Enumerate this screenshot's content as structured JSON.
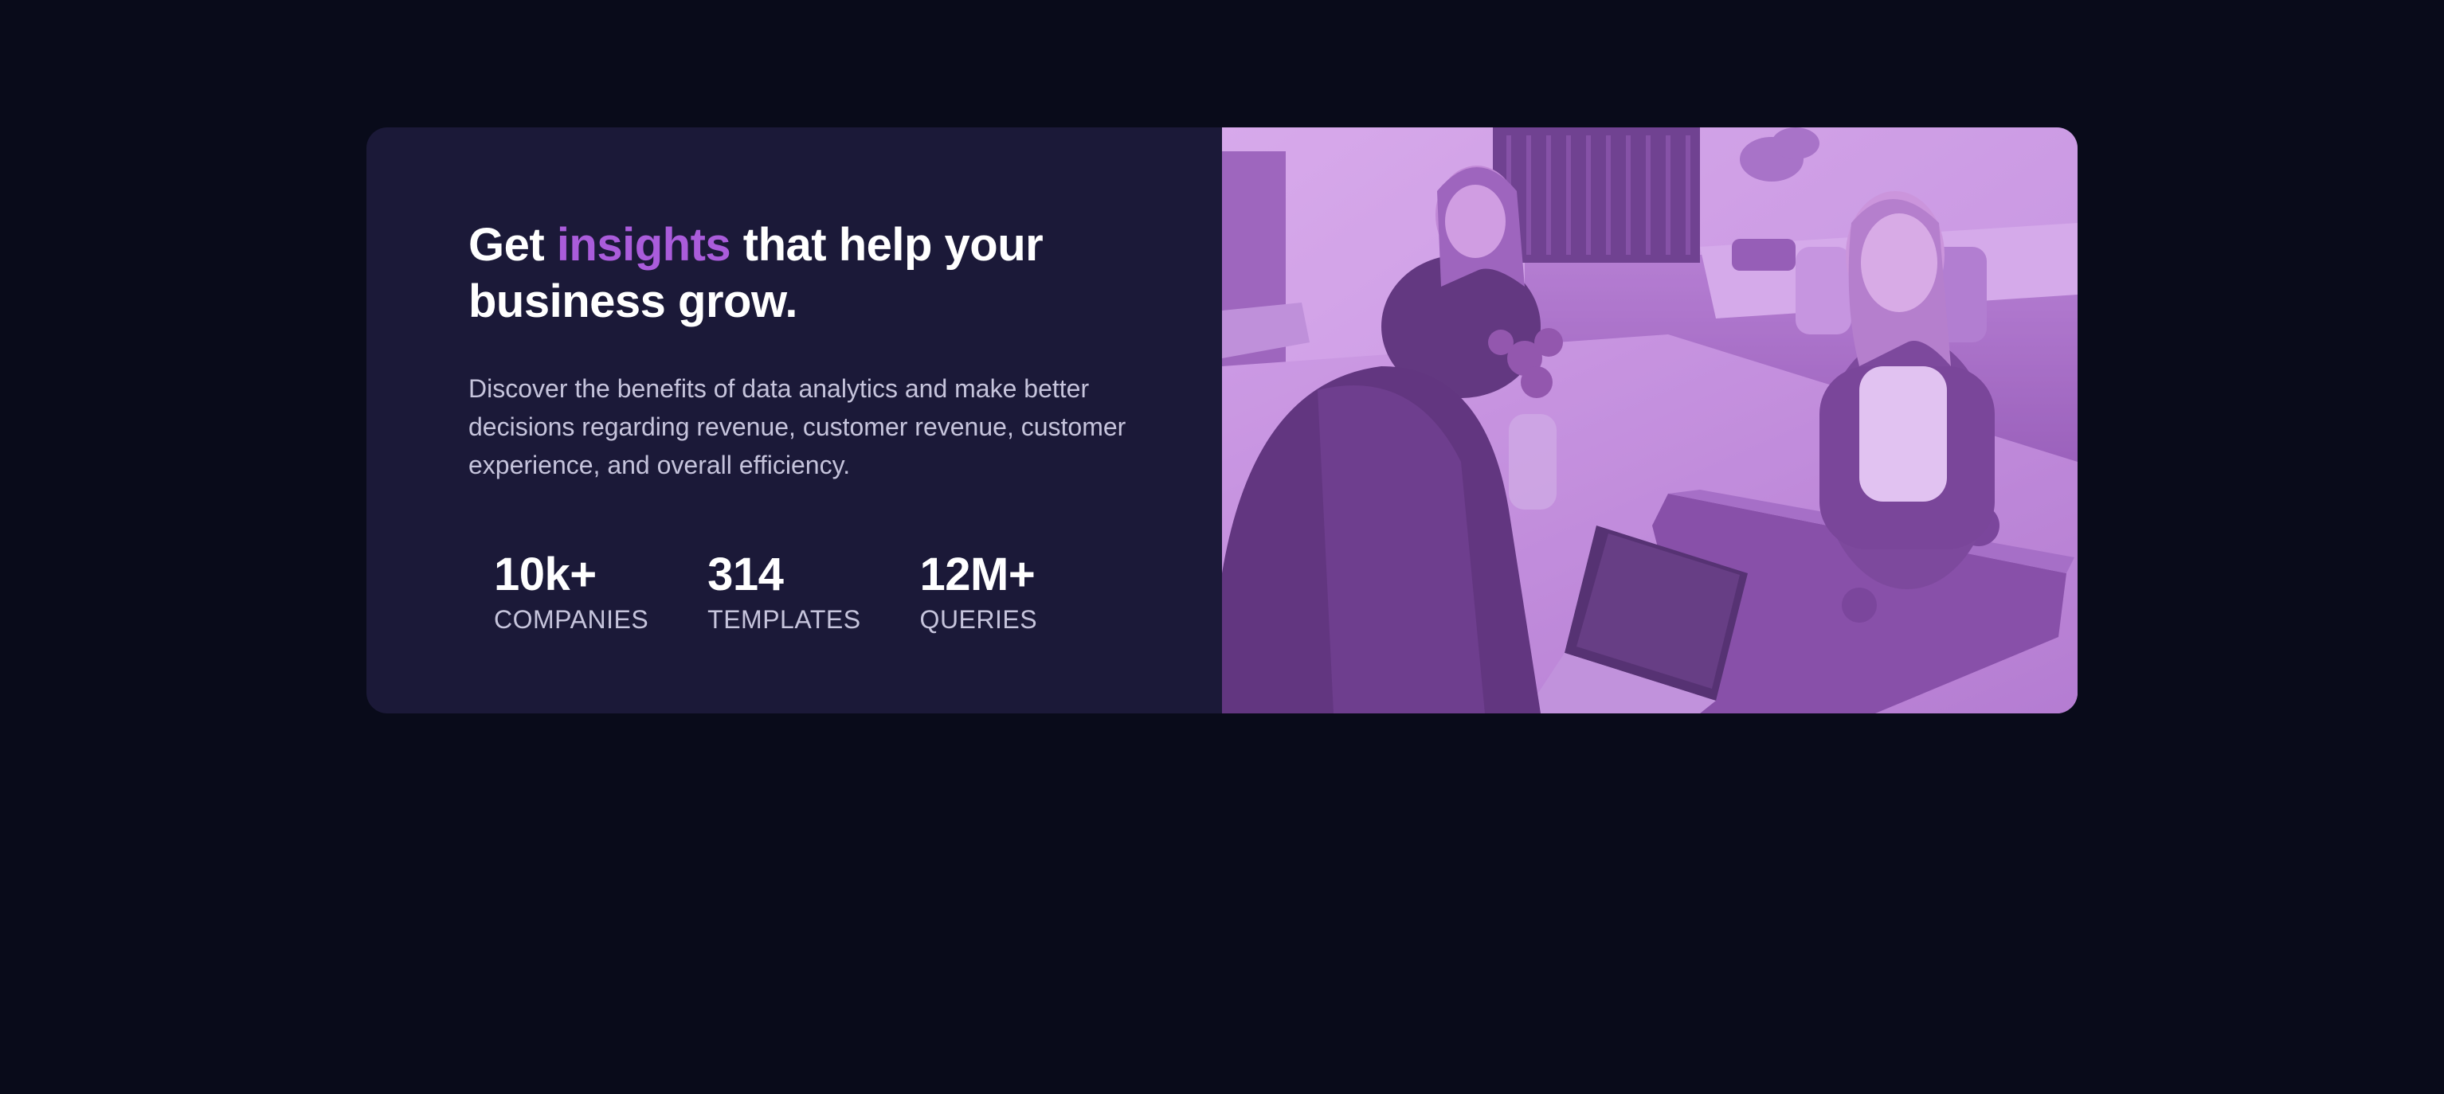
{
  "hero": {
    "headline_before": "Get ",
    "headline_accent": "insights",
    "headline_after": " that help your business grow.",
    "description": "Discover the benefits of data analytics and make better decisions regarding revenue, customer revenue, customer experience, and overall efficiency."
  },
  "stats": [
    {
      "value": "10k+",
      "label": "COMPANIES"
    },
    {
      "value": "314",
      "label": "TEMPLATES"
    },
    {
      "value": "12M+",
      "label": "QUERIES"
    }
  ],
  "colors": {
    "page_background": "#090b1a",
    "card_background": "#1b1938",
    "accent": "#aa5cdb",
    "heading": "#ffffff",
    "body_text": "#c6c4dc",
    "image_overlay": "#aa5cdb"
  }
}
